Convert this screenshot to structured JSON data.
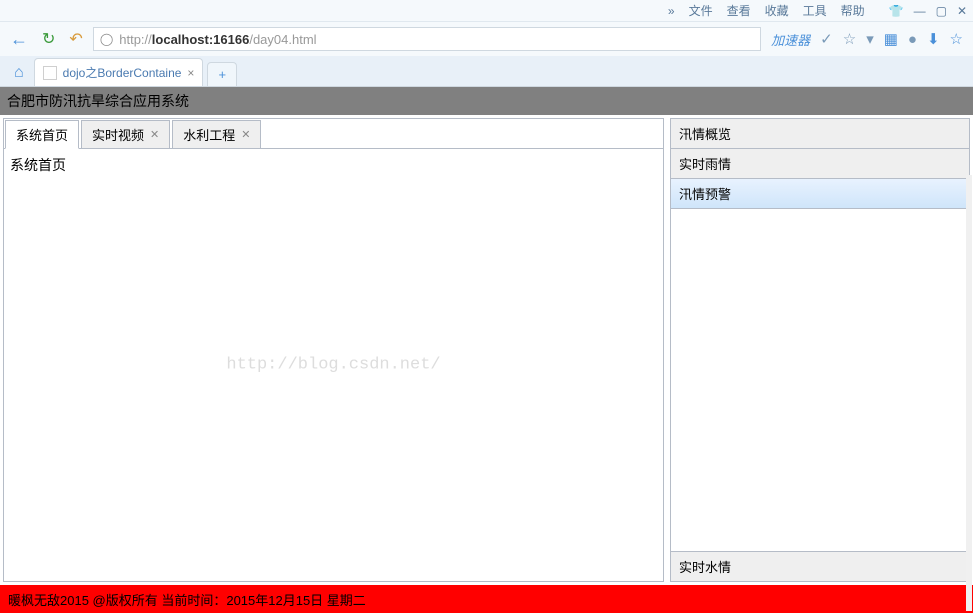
{
  "browser": {
    "menu": [
      "文件",
      "查看",
      "收藏",
      "工具",
      "帮助"
    ],
    "more": "»",
    "url_prefix": "http://",
    "url_host": "localhost:16166",
    "url_path": "/day04.html",
    "accel": "加速器",
    "tab_title": "dojo之BorderContaine",
    "newtab": "+"
  },
  "header": {
    "title": "合肥市防汛抗旱综合应用系统"
  },
  "tabs": {
    "items": [
      {
        "label": "系统首页",
        "closable": false
      },
      {
        "label": "实时视频",
        "closable": true
      },
      {
        "label": "水利工程",
        "closable": true
      }
    ],
    "active_content": "系统首页"
  },
  "accordion": {
    "items": [
      {
        "label": "汛情概览"
      },
      {
        "label": "实时雨情"
      },
      {
        "label": "汛情预警"
      },
      {
        "label": "实时水情"
      }
    ],
    "selected_index": 2
  },
  "footer": {
    "text": "暖枫无敌2015 @版权所有  当前时间：2015年12月15日  星期二"
  },
  "watermark": "http://blog.csdn.net/"
}
